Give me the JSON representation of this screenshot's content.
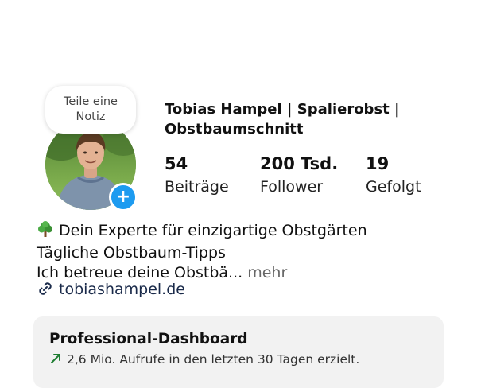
{
  "note": {
    "line1": "Teile eine",
    "line2": "Notiz"
  },
  "profile": {
    "name_line1": "Tobias Hampel | Spalierobst |",
    "name_line2": "Obstbaumschnitt",
    "add_badge": "+"
  },
  "stats": {
    "posts": {
      "count": "54",
      "label": "Beiträge"
    },
    "followers": {
      "count": "200 Tsd.",
      "label": "Follower"
    },
    "following": {
      "count": "19",
      "label": "Gefolgt"
    }
  },
  "bio": {
    "line1": "Dein Experte für einzigartige Obstgärten",
    "line2": "Tägliche Obstbaum-Tipps",
    "line3": "Ich betreue deine Obstbä...",
    "more": "mehr",
    "tree_icon": "deciduous-tree-emoji"
  },
  "website": {
    "url": "tobiashampel.de",
    "icon": "link-icon"
  },
  "dashboard": {
    "title": "Professional-Dashboard",
    "stat": "2,6 Mio. Aufrufe in den letzten 30 Tagen erzielt.",
    "trend_icon": "arrow-up-right-icon"
  },
  "colors": {
    "accent_blue": "#1d9bf0",
    "trend_green": "#1e7d32"
  }
}
